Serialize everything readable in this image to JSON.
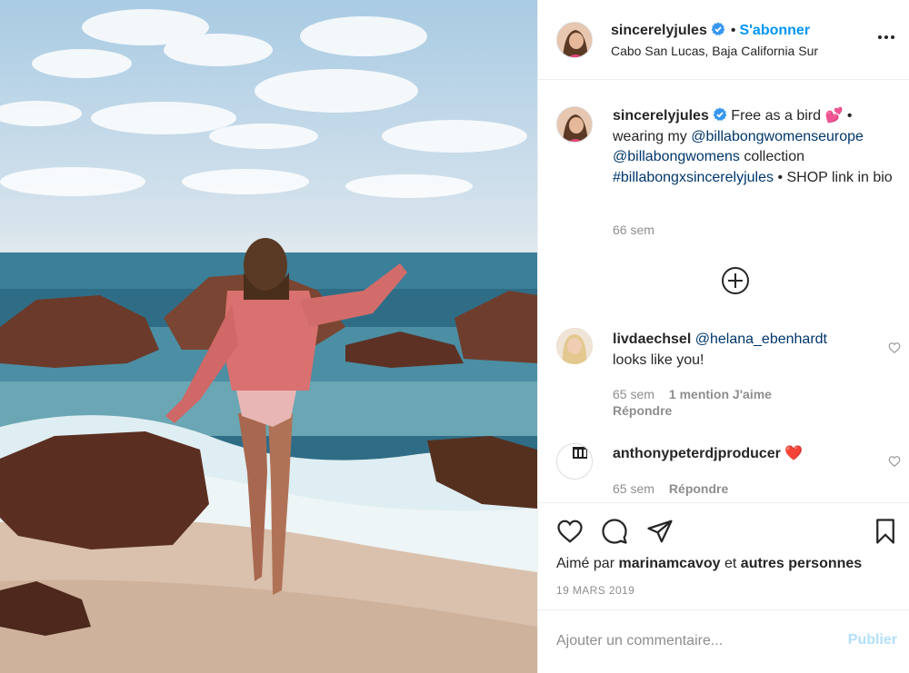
{
  "post": {
    "author": "sincerelyjules",
    "follow_label": "S'abonner",
    "location": "Cabo San Lucas, Baja California Sur",
    "verified_color": "#3897f0",
    "accent_color": "#0095f6"
  },
  "caption": {
    "username": "sincerelyjules",
    "text_before": "Free as a bird",
    "emoji": "💕",
    "text_after": " • wearing my ",
    "mention_1": "@billabongwomenseurope",
    "mention_2": "@billabongwomens",
    "text_collection": " collection ",
    "hashtag": "#billabongxsincerelyjules",
    "text_end": " • SHOP link in bio",
    "time": "66 sem"
  },
  "comments": [
    {
      "username": "livdaechsel",
      "mention": "@helana_ebenhardt",
      "text": "looks like you!",
      "time": "65 sem",
      "likes": "1 mention J'aime",
      "reply_label": "Répondre"
    },
    {
      "username": "anthonypeterdjproducer",
      "emoji": "❤️",
      "time": "65 sem",
      "reply_label": "Répondre"
    }
  ],
  "actions": {
    "liked_prefix": "Aimé par",
    "liked_user": "marinamcavoy",
    "liked_connector": "et",
    "liked_others": "autres personnes",
    "date": "19 MARS 2019"
  },
  "add_comment": {
    "placeholder": "Ajouter un commentaire...",
    "publish_label": "Publier"
  },
  "icons": {
    "more": "more-horizontal-icon",
    "load_more": "plus-circle-icon",
    "like": "heart-icon",
    "comment": "comment-bubble-icon",
    "share": "paper-plane-icon",
    "save": "bookmark-icon"
  }
}
